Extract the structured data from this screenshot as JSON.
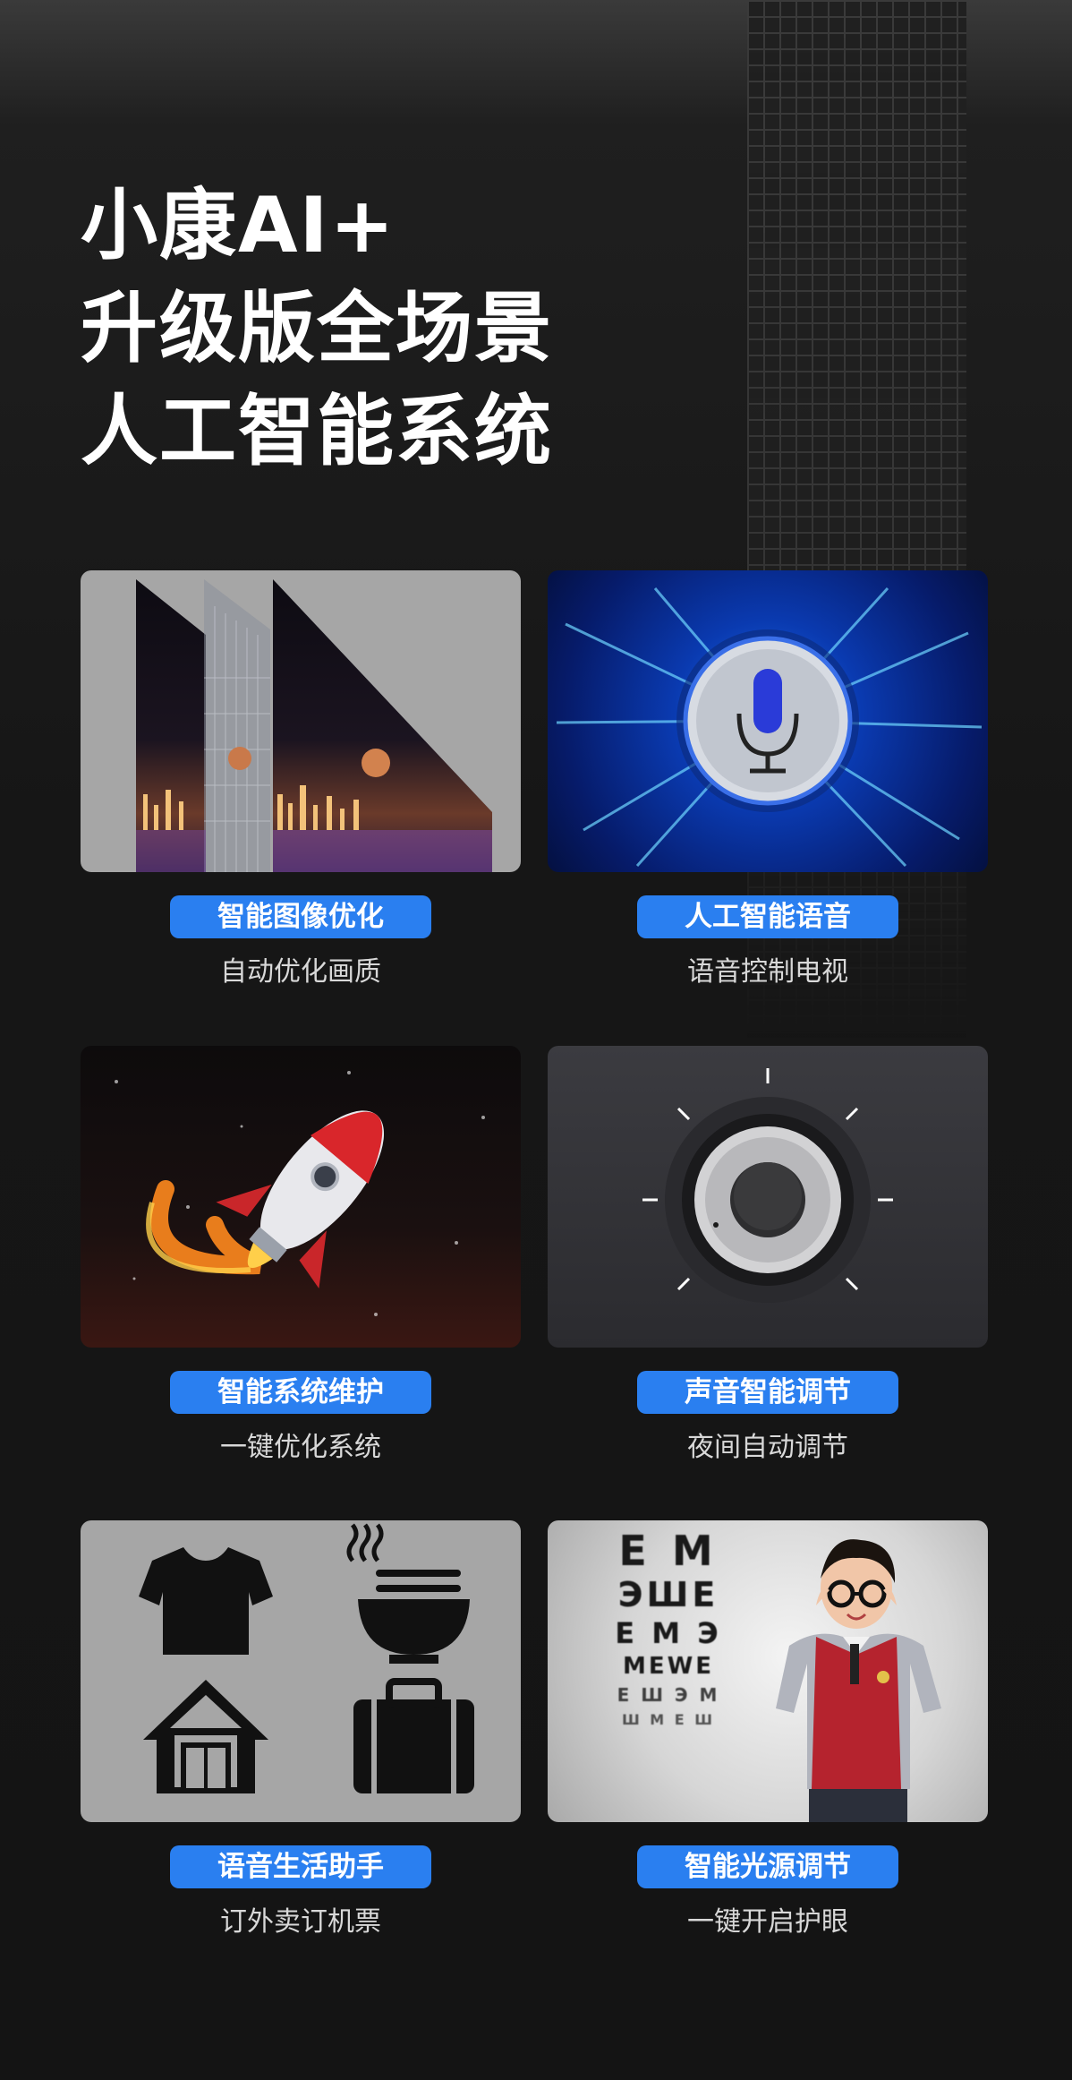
{
  "headline": {
    "line1": "小康AI+",
    "line2": "升级版全场景",
    "line3": "人工智能系统"
  },
  "features": [
    {
      "tag": "智能图像优化",
      "desc": "自动优化画质",
      "icon": "tv-layers-image"
    },
    {
      "tag": "人工智能语音",
      "desc": "语音控制电视",
      "icon": "microphone-icon"
    },
    {
      "tag": "智能系统维护",
      "desc": "一键优化系统",
      "icon": "rocket-icon"
    },
    {
      "tag": "声音智能调节",
      "desc": "夜间自动调节",
      "icon": "volume-knob-icon"
    },
    {
      "tag": "语音生活助手",
      "desc": "订外卖订机票",
      "icon": "life-services-icons"
    },
    {
      "tag": "智能光源调节",
      "desc": "一键开启护眼",
      "icon": "eye-chart-child-image"
    }
  ],
  "eye_chart_letters": [
    "E M",
    "ЭШE",
    "E M Э",
    "MEWE",
    "E Ш Э M",
    "Ш M E Ш"
  ],
  "colors": {
    "accent": "#2a7ff0",
    "background": "#161616",
    "card_gray": "#a6a6a6"
  }
}
